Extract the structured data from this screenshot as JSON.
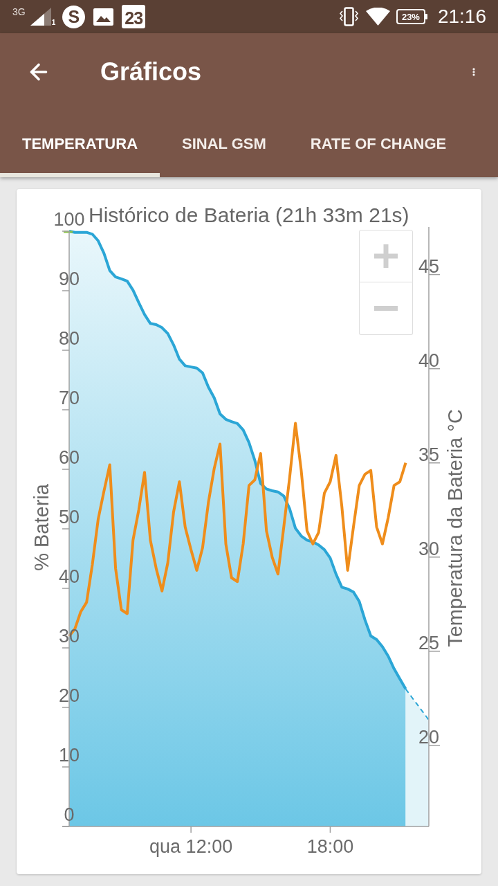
{
  "status_bar": {
    "network": "3G",
    "sim": "1",
    "notifications": [
      {
        "kind": "chat",
        "glyph": "S"
      },
      {
        "kind": "gallery"
      },
      {
        "kind": "calendar",
        "text": "23"
      }
    ],
    "battery": "23%",
    "time": "21:16"
  },
  "app_bar": {
    "title": "Gráficos"
  },
  "tabs": [
    {
      "label": "TEMPERATURA",
      "selected": true
    },
    {
      "label": "SINAL GSM",
      "selected": false
    },
    {
      "label": "RATE OF CHANGE",
      "selected": false
    }
  ],
  "chart": {
    "chart_data": {
      "type": "area",
      "title": "Histórico de Bateria (21h 33m 21s)",
      "ylabel": "% Bateria",
      "y2label": "Temperatura da Bateria °C",
      "categories": [
        null,
        null,
        null,
        null,
        null,
        null,
        null,
        null,
        null,
        null,
        null,
        null,
        null,
        null,
        null,
        null,
        null,
        null,
        null,
        null,
        null,
        "qua 12:00",
        null,
        null,
        null,
        null,
        null,
        null,
        null,
        null,
        null,
        null,
        null,
        null,
        null,
        null,
        null,
        null,
        null,
        null,
        null,
        null,
        null,
        null,
        null,
        "18:00",
        null,
        null,
        null,
        null,
        null,
        null,
        null,
        null,
        null,
        null,
        null,
        null,
        null,
        null,
        null,
        null,
        null
      ],
      "ylim": [
        0,
        100
      ],
      "yticks": [
        0,
        10,
        20,
        30,
        40,
        50,
        60,
        70,
        80,
        90,
        100
      ],
      "y2lim": [
        15.7,
        47.3
      ],
      "y2ticks": [
        20,
        25,
        30,
        35,
        40,
        45
      ],
      "series": [
        {
          "color": "#2ba6d6",
          "values": [
            100,
            99.8,
            99.8,
            99.8,
            99.5,
            98.4,
            96.3,
            93.4,
            92.3,
            92,
            91.6,
            90.1,
            88,
            86,
            84.5,
            84.3,
            83.8,
            82.8,
            80.9,
            78.5,
            77.4,
            77.2,
            77,
            76.2,
            73.8,
            72,
            69.3,
            68.4,
            68,
            67.7,
            66.6,
            64.5,
            61.5,
            57.6,
            56.7,
            56.4,
            56.2,
            55.5,
            53.4,
            50.1,
            48.8,
            48.1,
            47.8,
            47.3,
            46.5,
            45.1,
            42.4,
            40.2,
            39.9,
            39.4,
            37.8,
            34.7,
            32,
            31.4,
            30.2,
            28.6,
            26.5,
            24.8,
            23.1,
            null,
            null,
            null,
            null
          ]
        },
        {
          "color": "#2ba6d6",
          "values": [
            null,
            null,
            null,
            null,
            null,
            null,
            null,
            null,
            null,
            null,
            null,
            null,
            null,
            null,
            null,
            null,
            null,
            null,
            null,
            null,
            null,
            null,
            null,
            null,
            null,
            null,
            null,
            null,
            null,
            null,
            null,
            null,
            null,
            null,
            null,
            null,
            null,
            null,
            null,
            null,
            null,
            null,
            null,
            null,
            null,
            null,
            null,
            null,
            null,
            null,
            null,
            null,
            null,
            null,
            null,
            null,
            null,
            null,
            23.1,
            21.8,
            20.5,
            19.2,
            17.9
          ]
        },
        {
          "type": "line",
          "axis": "y2",
          "color": "#ef8d1b",
          "values": [
            25.8,
            26.2,
            27.1,
            27.6,
            29.6,
            32,
            33.5,
            34.9,
            29.4,
            27.2,
            27,
            30.9,
            32.5,
            34.5,
            30.9,
            29.4,
            28.2,
            29.7,
            32.4,
            34,
            31.6,
            30.4,
            29.3,
            30.5,
            32.9,
            34.7,
            36,
            30.7,
            28.9,
            28.7,
            30.7,
            33.8,
            34.1,
            35.5,
            31.4,
            30,
            29.1,
            31.6,
            34.2,
            37.1,
            34.6,
            31.4,
            30.7,
            31.3,
            33.4,
            34,
            35.4,
            32.7,
            29.3,
            31.6,
            33.8,
            34.4,
            34.6,
            31.6,
            30.7,
            32.1,
            33.8,
            34,
            35,
            null,
            null,
            null,
            null
          ]
        }
      ]
    }
  }
}
